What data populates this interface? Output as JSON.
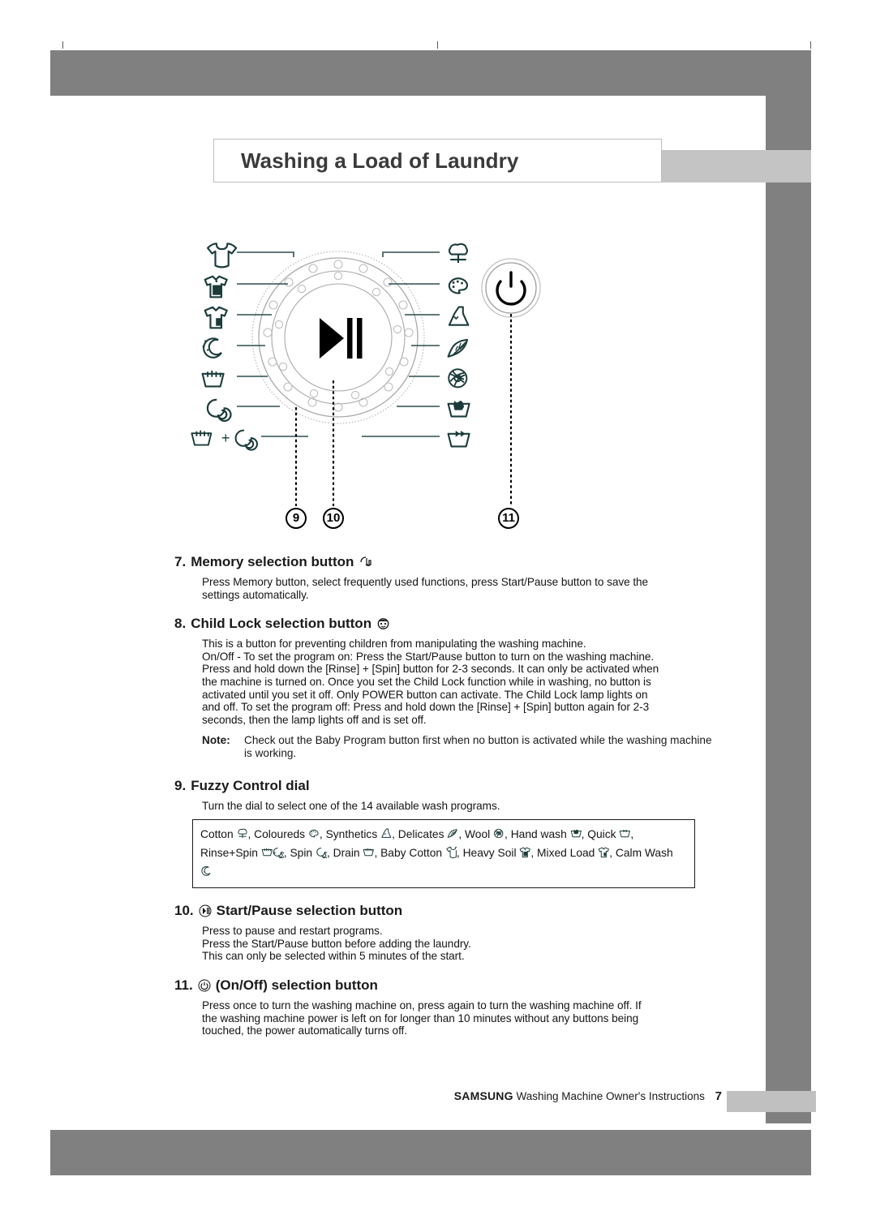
{
  "page": {
    "title": "Washing a Load of Laundry",
    "number": "7"
  },
  "colors": {
    "frame_dark": "#808080",
    "frame_light": "#c4c4c4",
    "diagram_leader": "#2f4f4f",
    "diagram_outline": "#9a9a9a",
    "text": "#141414"
  },
  "diagram": {
    "name": "control-panel-dial-diagram",
    "left_icons": [
      "baby-cotton-icon",
      "heavy-soil-icon",
      "mixed-load-icon",
      "calm-wash-icon",
      "drain-icon",
      "spin-icon",
      "rinse-plus-spin-icon"
    ],
    "right_icons": [
      "cotton-icon",
      "coloureds-icon",
      "synthetics-icon",
      "delicates-icon",
      "wool-icon",
      "hand-wash-icon",
      "quick-icon"
    ],
    "dial_center_icon": "start-pause-icon",
    "power_button_icon": "power-icon",
    "callouts": [
      "9",
      "10",
      "11"
    ]
  },
  "sections": [
    {
      "number": "7.",
      "heading": "Memory selection button",
      "heading_icon": "memory-hand-icon",
      "paragraphs": [
        "Press Memory button, select frequently used functions, press Start/Pause button to save the",
        "settings automatically."
      ]
    },
    {
      "number": "8.",
      "heading": "Child Lock selection button",
      "heading_icon": "child-lock-face-icon",
      "paragraphs": [
        "This is a button for preventing children from manipulating the washing machine.",
        "On/Off - To set the program on: Press the Start/Pause button to turn on the washing machine.",
        "Press and hold down the [Rinse] + [Spin] button for 2-3 seconds. It can only be activated when",
        "the machine is turned on. Once you set the Child Lock function while in washing, no button is",
        "activated until you set it off.  Only POWER button can activate. The Child Lock lamp lights on",
        "and off. To set the program off: Press and hold down the [Rinse] + [Spin] button again for 2-3",
        "seconds, then the lamp lights off and is set off."
      ],
      "note_label": "Note:",
      "note_text": "Check out the Baby Program button first when no button is activated while the washing machine is working."
    },
    {
      "number": "9.",
      "heading": "Fuzzy Control dial",
      "heading_icon": "",
      "paragraphs": [
        "Turn the dial to select one of the 14 available wash programs."
      ]
    },
    {
      "number": "10.",
      "heading": "Start/Pause selection button",
      "heading_icon": "start-pause-icon",
      "paragraphs": [
        "Press to pause and restart programs.",
        "Press the Start/Pause button before adding the laundry.",
        "This can only be selected within 5 minutes of the start."
      ]
    },
    {
      "number": "11.",
      "heading": "(On/Off) selection button",
      "heading_icon": "power-icon",
      "paragraphs": [
        "Press once to turn the washing machine on, press again to turn the washing machine off. If",
        "the washing machine power is left on for longer than 10 minutes without any buttons being",
        "touched, the power automatically turns off."
      ]
    }
  ],
  "program_list": {
    "line1": "Cotton  , Coloureds  , Synthetics  , Delicates  , Wool  , Hand wash  , Quick",
    "line2": ", Rinse+Spin      , Spin  , Drain  , Baby Cotton  , Heavy Soil  , Mixed Load  ,",
    "line3": "Calm Wash",
    "programs": [
      {
        "label": "Cotton",
        "icon": "cotton-icon"
      },
      {
        "label": "Coloureds",
        "icon": "coloureds-icon"
      },
      {
        "label": "Synthetics",
        "icon": "synthetics-icon"
      },
      {
        "label": "Delicates",
        "icon": "delicates-icon"
      },
      {
        "label": "Wool",
        "icon": "wool-icon"
      },
      {
        "label": "Hand wash",
        "icon": "hand-wash-icon"
      },
      {
        "label": "Quick",
        "icon": "quick-icon"
      },
      {
        "label": "Rinse+Spin",
        "icon": "rinse-plus-spin-icon"
      },
      {
        "label": "Spin",
        "icon": "spin-icon"
      },
      {
        "label": "Drain",
        "icon": "drain-icon"
      },
      {
        "label": "Baby Cotton",
        "icon": "baby-cotton-icon"
      },
      {
        "label": "Heavy Soil",
        "icon": "heavy-soil-icon"
      },
      {
        "label": "Mixed Load",
        "icon": "mixed-load-icon"
      },
      {
        "label": "Calm Wash",
        "icon": "calm-wash-icon"
      }
    ]
  },
  "footer": {
    "brand": "SAMSUNG",
    "text": "Washing Machine Owner's Instructions",
    "page_number": "7"
  }
}
